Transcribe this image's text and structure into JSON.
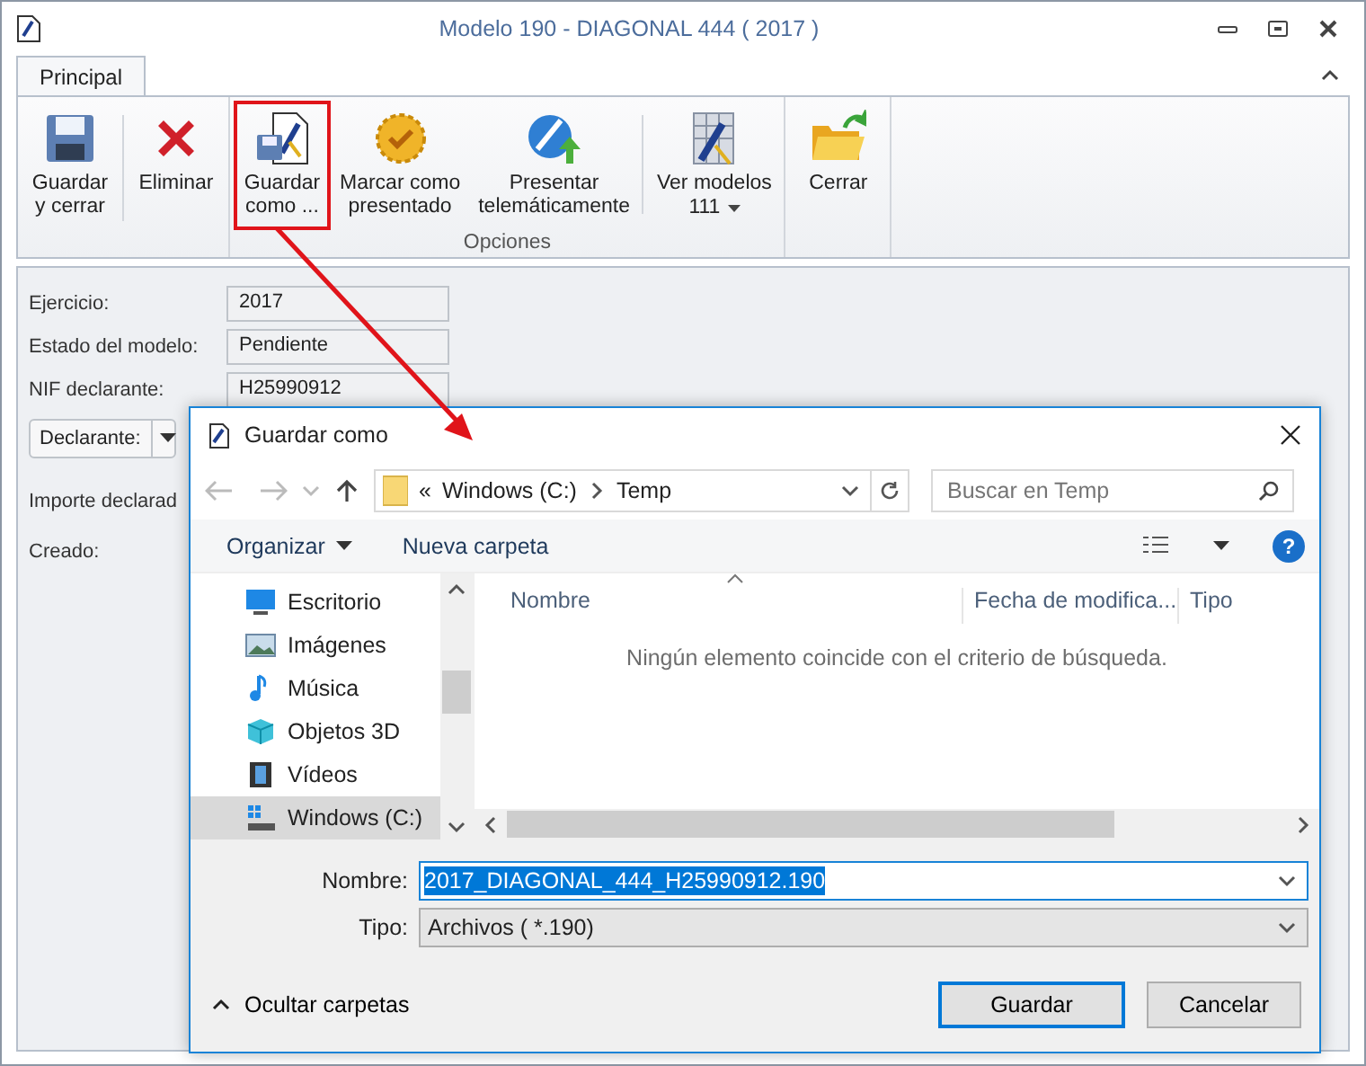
{
  "window": {
    "title": "Modelo 190 - DIAGONAL 444 ( 2017 )"
  },
  "tabs": [
    {
      "label": "Principal",
      "selected": true
    }
  ],
  "ribbon": {
    "groups": [
      {
        "buttons": [
          {
            "label": "Guardar\ny cerrar",
            "kind": "save",
            "highlighted": false,
            "dropdown": false
          },
          {
            "label": "Eliminar",
            "kind": "delete",
            "highlighted": false,
            "dropdown": false
          }
        ]
      },
      {
        "label": "Opciones",
        "buttons": [
          {
            "label": "Guardar\ncomo ...",
            "kind": "saveas",
            "highlighted": true,
            "dropdown": false
          },
          {
            "label": "Marcar como\npresentado",
            "kind": "seal",
            "highlighted": false,
            "dropdown": false
          },
          {
            "label": "Presentar\ntelemáticamente",
            "kind": "globe",
            "highlighted": false,
            "dropdown": false
          },
          {
            "label": "Ver modelos\n111",
            "kind": "models",
            "highlighted": false,
            "dropdown": true
          }
        ]
      },
      {
        "buttons": [
          {
            "label": "Cerrar",
            "kind": "folder",
            "highlighted": false,
            "dropdown": false
          }
        ]
      }
    ]
  },
  "form": {
    "fields": [
      {
        "kind": "text",
        "label": "Ejercicio:",
        "value": "2017"
      },
      {
        "kind": "text",
        "label": "Estado del modelo:",
        "value": "Pendiente"
      },
      {
        "kind": "text",
        "label": "NIF declarante:",
        "value": "H25990912"
      },
      {
        "kind": "dropdown",
        "label": "Declarante:"
      },
      {
        "kind": "label",
        "label": "Importe declarad"
      },
      {
        "kind": "label",
        "label": "Creado:"
      }
    ]
  },
  "dialog": {
    "title": "Guardar como",
    "path": {
      "prefix": "«",
      "segments": [
        "Windows (C:)",
        "Temp"
      ]
    },
    "search": {
      "placeholder": "Buscar en Temp"
    },
    "toolbar": {
      "organize": "Organizar",
      "new_folder": "Nueva carpeta",
      "help": "?"
    },
    "sidebar": [
      {
        "label": "Escritorio",
        "kind": "desktop",
        "selected": false
      },
      {
        "label": "Imágenes",
        "kind": "pictures",
        "selected": false
      },
      {
        "label": "Música",
        "kind": "music",
        "selected": false
      },
      {
        "label": "Objetos 3D",
        "kind": "cube",
        "selected": false
      },
      {
        "label": "Vídeos",
        "kind": "film",
        "selected": false
      },
      {
        "label": "Windows (C:)",
        "kind": "drive",
        "selected": true
      }
    ],
    "columns": [
      "Nombre",
      "Fecha de modifica...",
      "Tipo"
    ],
    "empty_message": "Ningún elemento coincide con el criterio de búsqueda.",
    "file_name": {
      "label": "Nombre:",
      "value": "2017_DIAGONAL_444_H25990912.190",
      "selected": true
    },
    "file_type": {
      "label": "Tipo:",
      "value": "Archivos  ( *.190)"
    },
    "hide_folders": "Ocultar carpetas",
    "buttons": [
      {
        "label": "Guardar",
        "default": true
      },
      {
        "label": "Cancelar",
        "default": false
      }
    ]
  }
}
